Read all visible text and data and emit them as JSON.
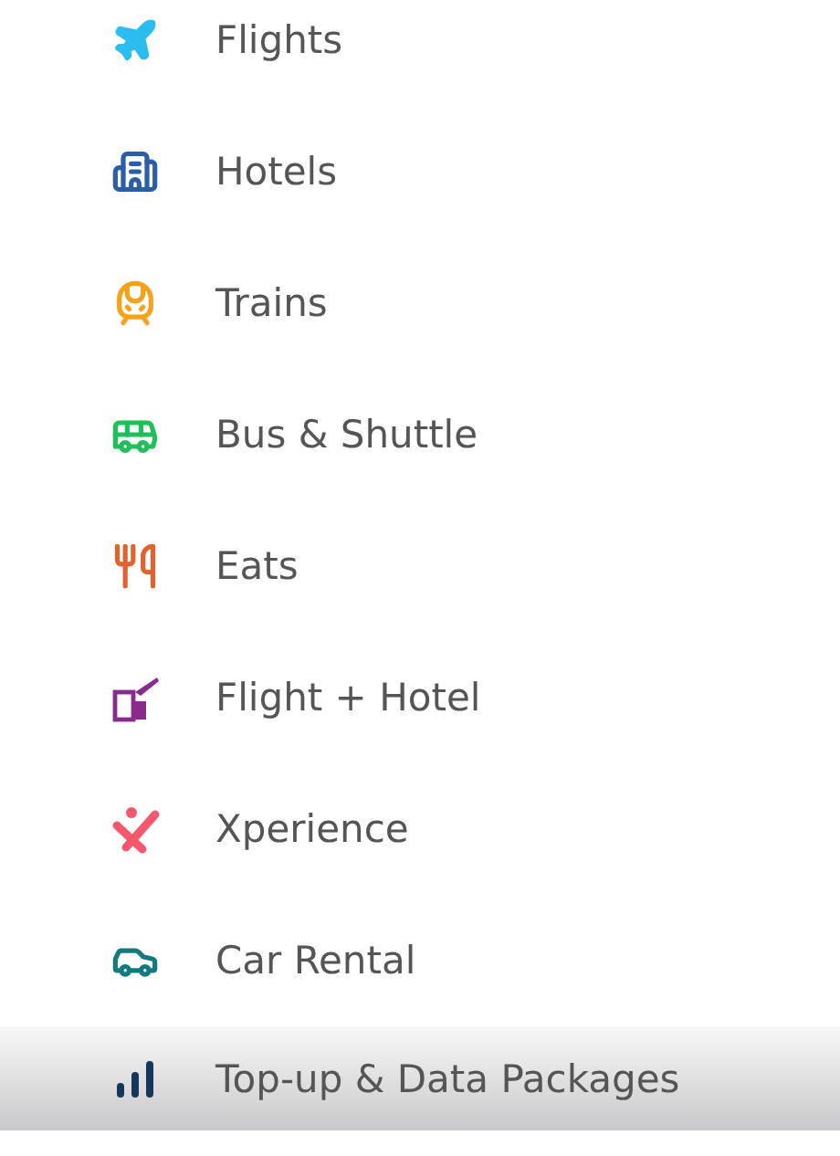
{
  "menu": {
    "items": [
      {
        "label": "Flights",
        "kind": "flight",
        "color": "#2bbcf0",
        "selected": false
      },
      {
        "label": "Hotels",
        "kind": "hotel",
        "color": "#2a5ea8",
        "selected": false
      },
      {
        "label": "Trains",
        "kind": "train",
        "color": "#f7a21b",
        "selected": false
      },
      {
        "label": "Bus & Shuttle",
        "kind": "bus",
        "color": "#1fbf5a",
        "selected": false
      },
      {
        "label": "Eats",
        "kind": "eats",
        "color": "#e0622e",
        "selected": false
      },
      {
        "label": "Flight + Hotel",
        "kind": "flight-hotel",
        "color": "#8a2a8c",
        "selected": false
      },
      {
        "label": "Xperience",
        "kind": "experience",
        "color": "#f5576c",
        "selected": false
      },
      {
        "label": "Car Rental",
        "kind": "car",
        "color": "#137a7f",
        "selected": false
      },
      {
        "label": "Top-up & Data Packages",
        "kind": "signal",
        "color": "#16375c",
        "selected": true
      }
    ]
  }
}
